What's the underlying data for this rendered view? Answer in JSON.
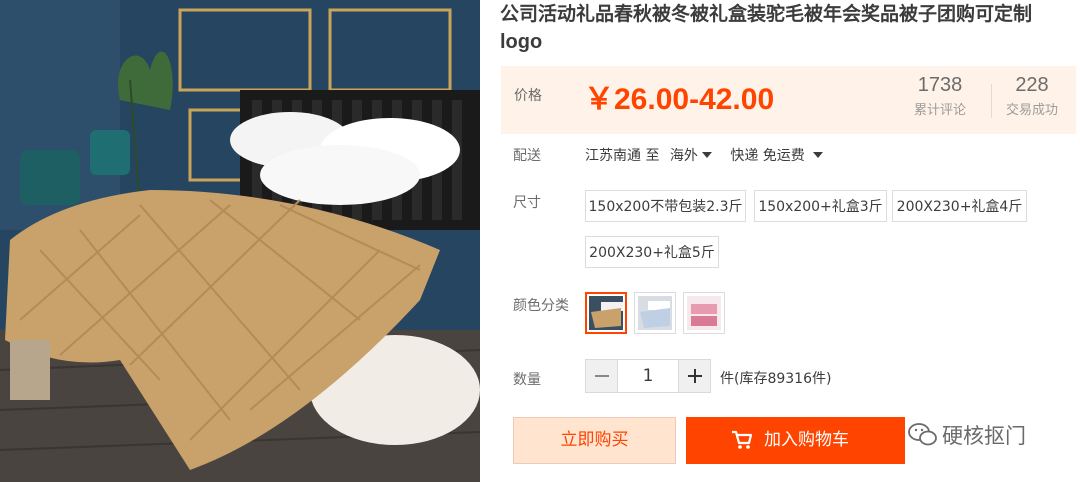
{
  "product": {
    "title_line1": "公司活动礼品春秋被冬被礼盒装驼毛被年会奖品被子团购可定制",
    "title_line2": "logo"
  },
  "price": {
    "label": "价格",
    "value": "￥26.00-42.00"
  },
  "stats": {
    "reviews_count": "1738",
    "reviews_label": "累计评论",
    "sales_count": "228",
    "sales_label": "交易成功"
  },
  "shipping": {
    "label": "配送",
    "from_to": "江苏南通 至",
    "destination": "海外",
    "method": "快递 免运费"
  },
  "size": {
    "label": "尺寸",
    "options": [
      "150x200不带包装2.3斤",
      "150x200+礼盒3斤",
      "200X230+礼盒4斤",
      "200X230+礼盒5斤"
    ]
  },
  "color": {
    "label": "颜色分类",
    "options": [
      "camel",
      "blue-white",
      "pink"
    ]
  },
  "quantity": {
    "label": "数量",
    "value": "1",
    "stock_text": "件(库存89316件)"
  },
  "actions": {
    "buy_now": "立即购买",
    "add_to_cart": "加入购物车"
  },
  "watermark": {
    "text": "硬核抠门"
  },
  "colors": {
    "accent": "#ff4400",
    "price_bg": "#fff2e8"
  }
}
